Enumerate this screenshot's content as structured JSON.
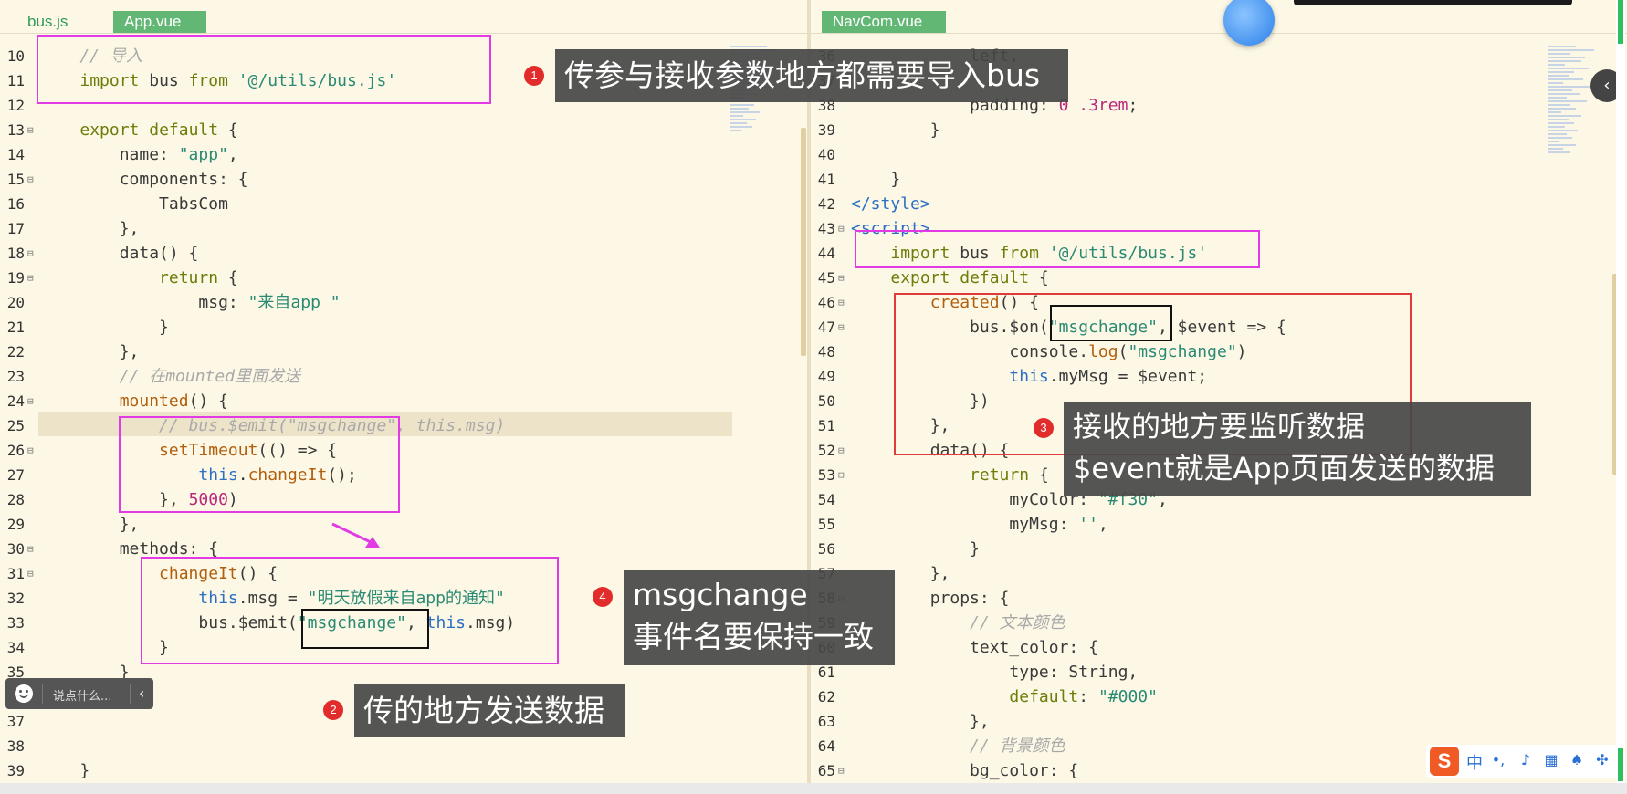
{
  "left_tabs": [
    {
      "label": "bus.js",
      "active": false
    },
    {
      "label": "App.vue",
      "active": true
    }
  ],
  "right_tabs": [
    {
      "label": "NavCom.vue",
      "active": true
    }
  ],
  "left_lines": [
    {
      "n": "10",
      "fold": false,
      "t": "    // 导入"
    },
    {
      "n": "11",
      "fold": false,
      "t": "    import bus from '@/utils/bus.js'"
    },
    {
      "n": "12",
      "fold": false,
      "t": ""
    },
    {
      "n": "13",
      "fold": true,
      "t": "    export default {"
    },
    {
      "n": "14",
      "fold": false,
      "t": "        name: \"app\","
    },
    {
      "n": "15",
      "fold": true,
      "t": "        components: {"
    },
    {
      "n": "16",
      "fold": false,
      "t": "            TabsCom"
    },
    {
      "n": "17",
      "fold": false,
      "t": "        },"
    },
    {
      "n": "18",
      "fold": true,
      "t": "        data() {"
    },
    {
      "n": "19",
      "fold": true,
      "t": "            return {"
    },
    {
      "n": "20",
      "fold": false,
      "t": "                msg: \"来自app \""
    },
    {
      "n": "21",
      "fold": false,
      "t": "            }"
    },
    {
      "n": "22",
      "fold": false,
      "t": "        },"
    },
    {
      "n": "23",
      "fold": false,
      "t": "        // 在mounted里面发送"
    },
    {
      "n": "24",
      "fold": true,
      "t": "        mounted() {"
    },
    {
      "n": "25",
      "fold": false,
      "t": "            // bus.$emit(\"msgchange\", this.msg)"
    },
    {
      "n": "26",
      "fold": true,
      "t": "            setTimeout(() => {"
    },
    {
      "n": "27",
      "fold": false,
      "t": "                this.changeIt();"
    },
    {
      "n": "28",
      "fold": false,
      "t": "            }, 5000)"
    },
    {
      "n": "29",
      "fold": false,
      "t": "        },"
    },
    {
      "n": "30",
      "fold": true,
      "t": "        methods: {"
    },
    {
      "n": "31",
      "fold": true,
      "t": "            changeIt() {"
    },
    {
      "n": "32",
      "fold": false,
      "t": "                this.msg = \"明天放假来自app的通知\""
    },
    {
      "n": "33",
      "fold": false,
      "t": "                bus.$emit(\"msgchange\", this.msg)"
    },
    {
      "n": "34",
      "fold": false,
      "t": "            }"
    },
    {
      "n": "35",
      "fold": false,
      "t": "        }"
    },
    {
      "n": "36",
      "fold": false,
      "t": ""
    },
    {
      "n": "37",
      "fold": false,
      "t": ""
    },
    {
      "n": "38",
      "fold": false,
      "t": ""
    },
    {
      "n": "39",
      "fold": false,
      "t": "    }"
    }
  ],
  "right_lines": [
    {
      "n": "36",
      "fold": false,
      "t": "            left,"
    },
    {
      "n": "37",
      "fold": false,
      "t": ""
    },
    {
      "n": "38",
      "fold": false,
      "t": "            padding: 0 .3rem;"
    },
    {
      "n": "39",
      "fold": false,
      "t": "        }"
    },
    {
      "n": "40",
      "fold": false,
      "t": ""
    },
    {
      "n": "41",
      "fold": false,
      "t": "    }"
    },
    {
      "n": "42",
      "fold": false,
      "t": "</style>"
    },
    {
      "n": "43",
      "fold": true,
      "t": "<script>"
    },
    {
      "n": "44",
      "fold": false,
      "t": "    import bus from '@/utils/bus.js'"
    },
    {
      "n": "45",
      "fold": true,
      "t": "    export default {"
    },
    {
      "n": "46",
      "fold": true,
      "t": "        created() {"
    },
    {
      "n": "47",
      "fold": true,
      "t": "            bus.$on(\"msgchange\", $event => {"
    },
    {
      "n": "48",
      "fold": false,
      "t": "                console.log(\"msgchange\")"
    },
    {
      "n": "49",
      "fold": false,
      "t": "                this.myMsg = $event;"
    },
    {
      "n": "50",
      "fold": false,
      "t": "            })"
    },
    {
      "n": "51",
      "fold": false,
      "t": "        },"
    },
    {
      "n": "52",
      "fold": true,
      "t": "        data() {"
    },
    {
      "n": "53",
      "fold": true,
      "t": "            return {"
    },
    {
      "n": "54",
      "fold": false,
      "t": "                myColor: \"#f30\","
    },
    {
      "n": "55",
      "fold": false,
      "t": "                myMsg: '',"
    },
    {
      "n": "56",
      "fold": false,
      "t": "            }"
    },
    {
      "n": "57",
      "fold": false,
      "t": "        },"
    },
    {
      "n": "58",
      "fold": true,
      "t": "        props: {"
    },
    {
      "n": "59",
      "fold": false,
      "t": "            // 文本颜色"
    },
    {
      "n": "60",
      "fold": false,
      "t": "            text_color: {"
    },
    {
      "n": "61",
      "fold": false,
      "t": "                type: String,"
    },
    {
      "n": "62",
      "fold": false,
      "t": "                default: \"#000\""
    },
    {
      "n": "63",
      "fold": false,
      "t": "            },"
    },
    {
      "n": "64",
      "fold": false,
      "t": "            // 背景颜色"
    },
    {
      "n": "65",
      "fold": true,
      "t": "            bg_color: {"
    }
  ],
  "annotations": {
    "note1": {
      "badge": "1",
      "text": "传参与接收参数地方都需要导入bus"
    },
    "note2": {
      "badge": "2",
      "text": "传的地方发送数据"
    },
    "note3": {
      "badge": "3",
      "line1": "接收的地方要监听数据",
      "line2": "$event就是App页面发送的数据"
    },
    "note4": {
      "badge": "4",
      "line1": "msgchange",
      "line2": "事件名要保持一致"
    }
  },
  "chat_bar": {
    "placeholder": "说点什么...",
    "collapse": "‹"
  },
  "ime": {
    "logo": "S",
    "lang": "中"
  },
  "colors": {
    "editor_bg": "#fdf8e6",
    "tab_active": "#63b775",
    "annotation_magenta": "#e23be5",
    "annotation_red": "#e03b3b",
    "badge_red": "#e22c2c"
  },
  "icons": [
    "smile-icon",
    "chevron-left-icon",
    "sogou-logo-icon",
    "mic-icon",
    "keyboard-icon",
    "shirt-icon",
    "grid-icon"
  ]
}
